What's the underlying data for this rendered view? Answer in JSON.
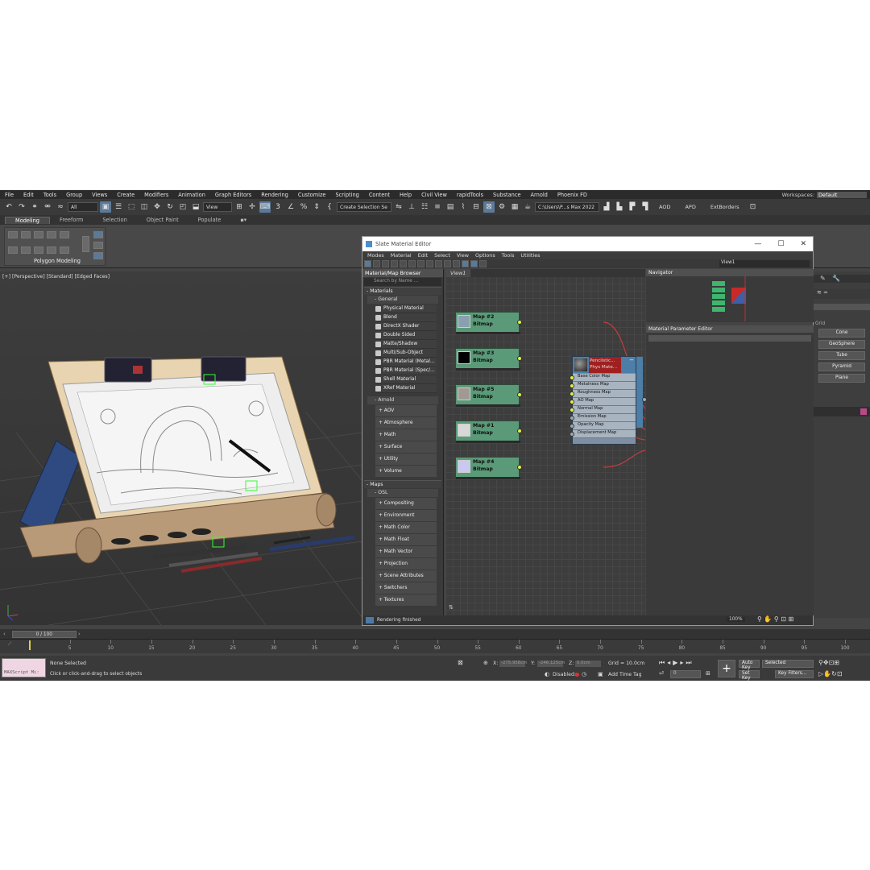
{
  "menubar": {
    "items": [
      "File",
      "Edit",
      "Tools",
      "Group",
      "Views",
      "Create",
      "Modifiers",
      "Animation",
      "Graph Editors",
      "Rendering",
      "Customize",
      "Scripting",
      "Content",
      "Help",
      "Civil View",
      "rapidTools",
      "Substance",
      "Arnold",
      "Phoenix FD"
    ],
    "workspaces_label": "Workspaces:",
    "workspaces_value": "Default"
  },
  "toolbar": {
    "filter_value": "All",
    "view_value": "View",
    "selection_set": "Create Selection Se",
    "path_value": "C:\\Users\\P...s Max 2022",
    "right_labels": [
      "AOD",
      "APD",
      "ExtBorders"
    ]
  },
  "ribbon": {
    "tabs": [
      "Modeling",
      "Freeform",
      "Selection",
      "Object Paint",
      "Populate"
    ],
    "active_tab": "Modeling",
    "group_label": "Polygon Modeling"
  },
  "viewport": {
    "label": "[+] [Perspective] [Standard] [Edged Faces]"
  },
  "slate": {
    "title": "Slate Material Editor",
    "menu": [
      "Modes",
      "Material",
      "Edit",
      "Select",
      "View",
      "Options",
      "Tools",
      "Utilities"
    ],
    "view_drop": "View1",
    "browser": {
      "header": "Material/Map Browser",
      "search_placeholder": "Search by Name ...",
      "materials_section": "- Materials",
      "general_sub": "- General",
      "general_items": [
        "Physical Material",
        "Blend",
        "DirectX Shader",
        "Double Sided",
        "Matte/Shadow",
        "Multi/Sub-Object",
        "PBR Material (Metal...",
        "PBR Material (Spec/...",
        "Shell Material",
        "XRef Material"
      ],
      "arnold_sub": "- Arnold",
      "arnold_groups": [
        "+ AOV",
        "+ Atmosphere",
        "+ Math",
        "+ Surface",
        "+ Utility",
        "+ Volume"
      ],
      "maps_section": "- Maps",
      "osl_sub": "- OSL",
      "osl_groups": [
        "+ Compositing",
        "+ Environment",
        "+ Math Color",
        "+ Math Float",
        "+ Math Vector",
        "+ Projection",
        "+ Scene Attributes",
        "+ Switchers",
        "+ Textures"
      ]
    },
    "canvas_tab": "View1",
    "nodes": [
      {
        "name": "Map #2",
        "type": "Bitmap",
        "thumb": "#8aa0b0"
      },
      {
        "name": "Map #3",
        "type": "Bitmap",
        "thumb": "#000000"
      },
      {
        "name": "Map #5",
        "type": "Bitmap",
        "thumb": "#a09a94"
      },
      {
        "name": "Map #1",
        "type": "Bitmap",
        "thumb": "#d8d8d8"
      },
      {
        "name": "Map #4",
        "type": "Bitmap",
        "thumb": "#c8c8f0"
      }
    ],
    "material_node": {
      "name": "Pencilstic...",
      "type": "Phys Mate...",
      "slots": [
        "Base Color Map",
        "Metalness Map",
        "Roughness Map",
        "AO Map",
        "Normal Map",
        "Emission Map",
        "Opacity Map",
        "Displacement Map"
      ]
    },
    "navigator_header": "Navigator",
    "param_header": "Material Parameter Editor",
    "status": "Rendering finished",
    "zoom": "100%"
  },
  "command_panel": {
    "section": "Grid",
    "buttons": [
      "Cone",
      "GeoSphere",
      "Tube",
      "Pyramid",
      "Plane"
    ]
  },
  "timeline": {
    "slider": "0 / 100",
    "ticks": [
      5,
      10,
      15,
      20,
      25,
      30,
      35,
      40,
      45,
      50,
      55,
      60,
      65,
      70,
      75,
      80,
      85,
      90,
      95,
      100
    ]
  },
  "status": {
    "maxscript": "MAXScript Mi:",
    "selection": "None Selected",
    "prompt": "Click or click-and-drag to select objects",
    "x_label": "X:",
    "x_val": "-275.958cm",
    "y_label": "Y:",
    "y_val": "-246.125cm",
    "z_label": "Z:",
    "z_val": "0.0cm",
    "grid": "Grid = 10.0cm",
    "disabled": "Disabled:",
    "add_time_tag": "Add Time Tag",
    "auto_key": "Auto Key",
    "selected": "Selected",
    "set_key": "Set Key",
    "key_filters": "Key Filters...",
    "frame": "0"
  },
  "colors": {
    "node_green": "#5a9a78",
    "port_yellow": "#e0ef4a",
    "wire_red": "#c83c3c",
    "material_blue": "#4d7ea8"
  }
}
